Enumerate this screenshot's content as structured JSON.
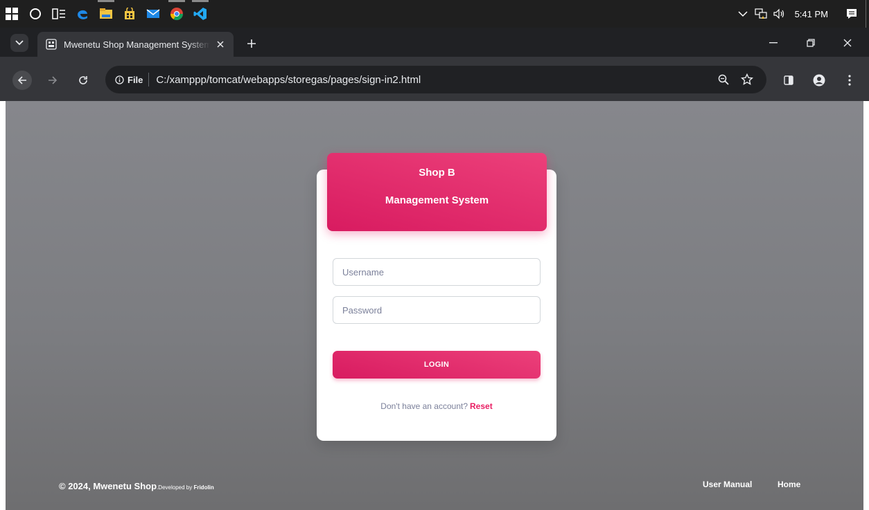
{
  "taskbar": {
    "clock": "5:41 PM",
    "icons": [
      "windows-start-icon",
      "cortana-icon",
      "task-view-icon",
      "edge-icon",
      "file-explorer-icon",
      "store-icon",
      "mail-icon",
      "chrome-icon",
      "vscode-icon"
    ]
  },
  "browser": {
    "tab_title": "Mwenetu Shop Management System",
    "site_chip": "File",
    "url": "C:/xamppp/tomcat/webapps/storegas/pages/sign-in2.html"
  },
  "card": {
    "header_line1": "Shop B",
    "header_line2": "Management System",
    "username_placeholder": "Username",
    "password_placeholder": "Password",
    "login_label": "LOGIN",
    "signup_text": "Don't have an account?",
    "reset_label": "Reset"
  },
  "footer": {
    "copyright": "© 2024, Mwenetu Shop",
    "developed_by_prefix": ".Developed by",
    "developer": "Fridolin",
    "user_manual": "User Manual",
    "home": "Home"
  },
  "colors": {
    "accent": "#e91e63",
    "accent_light": "#ec407a",
    "accent_dark": "#d81b60",
    "page_bg": "#7c7d81",
    "chrome_dark": "#202124",
    "chrome_toolbar": "#35363a",
    "taskbar": "#1f1f1f"
  }
}
